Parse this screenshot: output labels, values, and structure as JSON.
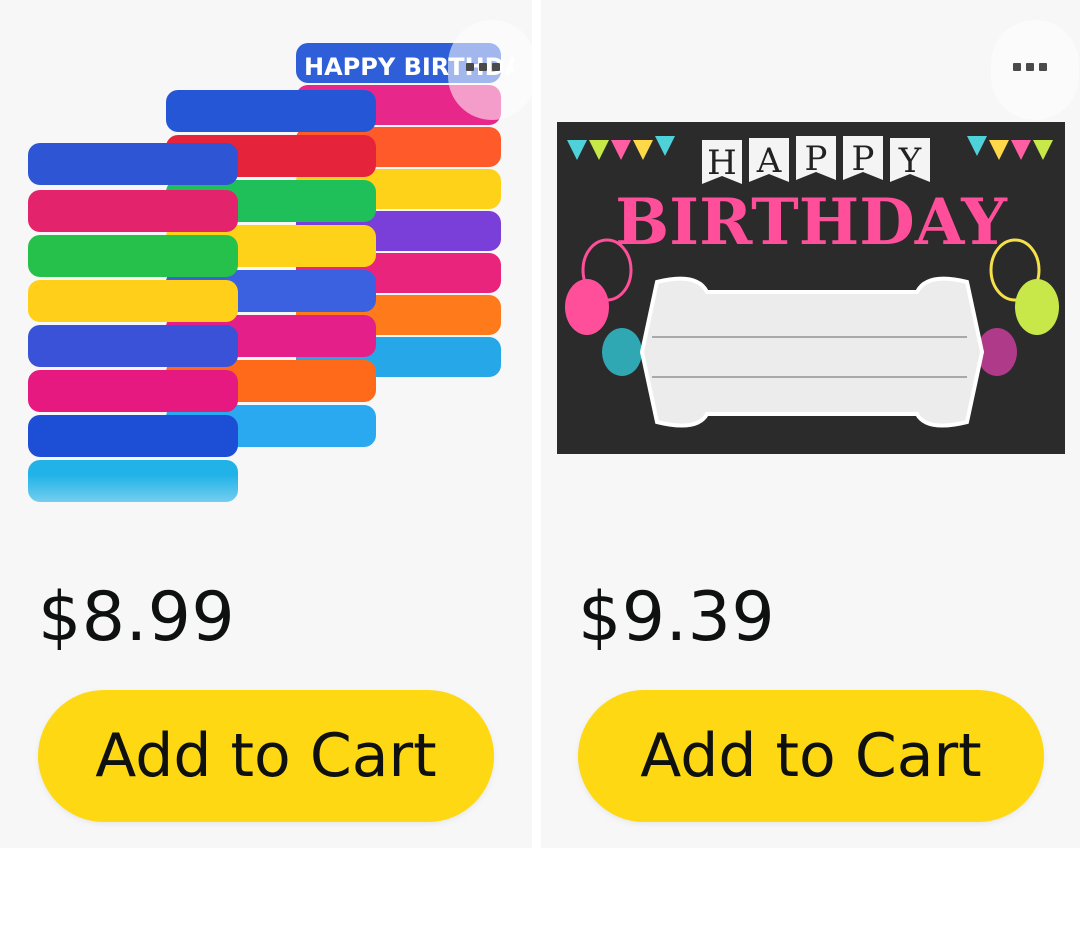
{
  "products": [
    {
      "image_alt": "Happy Birthday silicone wristbands",
      "band_text": "HAPPY BIRTHDAY",
      "price": "$8.99",
      "cart_label": "Add to Cart",
      "colors": {
        "button": "#ffd814"
      }
    },
    {
      "image_alt": "Happy Birthday chalkboard awards",
      "banner_text": "HAPPY",
      "headline": "BIRTHDAY",
      "price": "$9.39",
      "cart_label": "Add to Cart",
      "colors": {
        "button": "#ffd814"
      }
    }
  ]
}
